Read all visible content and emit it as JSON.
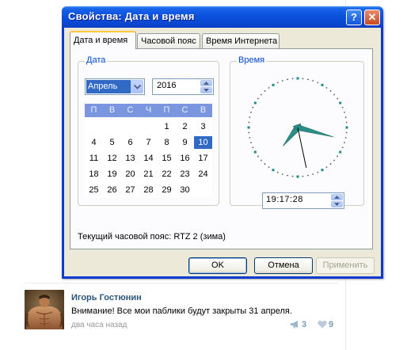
{
  "dialog": {
    "title": "Свойства: Дата и время",
    "help_glyph": "?",
    "close_glyph": "✕",
    "tabs": [
      "Дата и время",
      "Часовой пояс",
      "Время Интернета"
    ],
    "date_group": {
      "label": "Дата",
      "month": "Апрель",
      "year": "2016",
      "weekdays": [
        "П",
        "В",
        "С",
        "Ч",
        "П",
        "С",
        "В"
      ],
      "days": [
        "1",
        "2",
        "3",
        "4",
        "5",
        "6",
        "7",
        "8",
        "9",
        "10",
        "11",
        "12",
        "13",
        "14",
        "15",
        "16",
        "17",
        "18",
        "19",
        "20",
        "21",
        "22",
        "23",
        "24",
        "25",
        "26",
        "27",
        "28",
        "29",
        "30"
      ],
      "first_weekday_index": 4,
      "selected_day": "10"
    },
    "time_group": {
      "label": "Время",
      "time": "19:17:28",
      "hour": 19,
      "minute": 17,
      "second": 28
    },
    "timezone_text": "Текущий часовой пояс: RTZ 2 (зима)",
    "buttons": {
      "ok": "OK",
      "cancel": "Отмена",
      "apply": "Применить"
    },
    "colors": {
      "titlebar": "#0a4fdc",
      "selection": "#316ac5",
      "group_label": "#0046d5",
      "clock_hands": "#2a8f86"
    }
  },
  "post": {
    "author": "Игорь Гостюнин",
    "text": "Внимание! Все мои паблики будут закрыты 31 апреля.",
    "time": "два часа назад",
    "shares_icon": "megaphone-icon",
    "shares": "3",
    "likes_icon": "heart-icon",
    "likes": "9"
  }
}
